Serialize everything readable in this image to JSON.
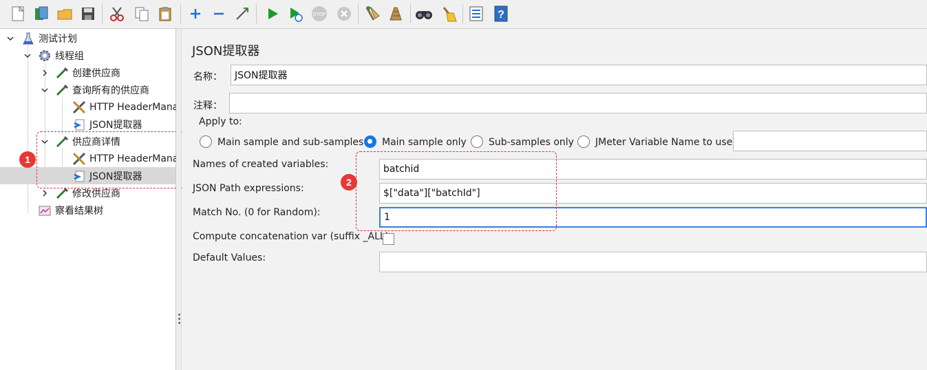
{
  "toolbar": {
    "icons": [
      "new-icon",
      "templates-icon",
      "open-icon",
      "save-icon",
      "cut-icon",
      "copy-icon",
      "paste-icon",
      "expand-icon",
      "collapse-icon",
      "toggle-icon",
      "start-icon",
      "start-no-pause-icon",
      "stop-icon",
      "shutdown-icon",
      "clear-icon",
      "clear-all-icon",
      "search-icon",
      "reset-search-icon",
      "function-helper-icon",
      "help-icon"
    ]
  },
  "tree": {
    "items": [
      {
        "label": "测试计划"
      },
      {
        "label": "线程组"
      },
      {
        "label": "创建供应商"
      },
      {
        "label": "查询所有的供应商"
      },
      {
        "label": "HTTP HeaderMana"
      },
      {
        "label": "JSON提取器"
      },
      {
        "label": "供应商详情"
      },
      {
        "label": "HTTP HeaderMana"
      },
      {
        "label": "JSON提取器"
      },
      {
        "label": "修改供应商"
      },
      {
        "label": "察看结果树"
      }
    ],
    "selected_index": 8
  },
  "panel": {
    "title": "JSON提取器",
    "name_label": "名称：",
    "name_value": "JSON提取器",
    "comment_label": "注释：",
    "comment_value": "",
    "apply_to_label": "Apply to:",
    "apply_options": [
      {
        "label": "Main sample and sub-samples",
        "selected": false
      },
      {
        "label": "Main sample only",
        "selected": true
      },
      {
        "label": "Sub-samples only",
        "selected": false
      },
      {
        "label": "JMeter Variable Name to use",
        "selected": false
      }
    ],
    "jmeter_var_value": "",
    "names_label": "Names of created variables:",
    "names_value": "batchid",
    "json_path_label": "JSON Path expressions:",
    "json_path_value": "$[\"data\"][\"batchId\"]",
    "match_no_label": "Match No. (0 for Random):",
    "match_no_value": "1",
    "concat_label": "Compute concatenation var (suffix _ALL):",
    "concat_checked": false,
    "default_values_label": "Default Values:",
    "default_values_value": ""
  },
  "annotations": {
    "badge1": "1",
    "badge2": "2",
    "color": "#e53935"
  }
}
